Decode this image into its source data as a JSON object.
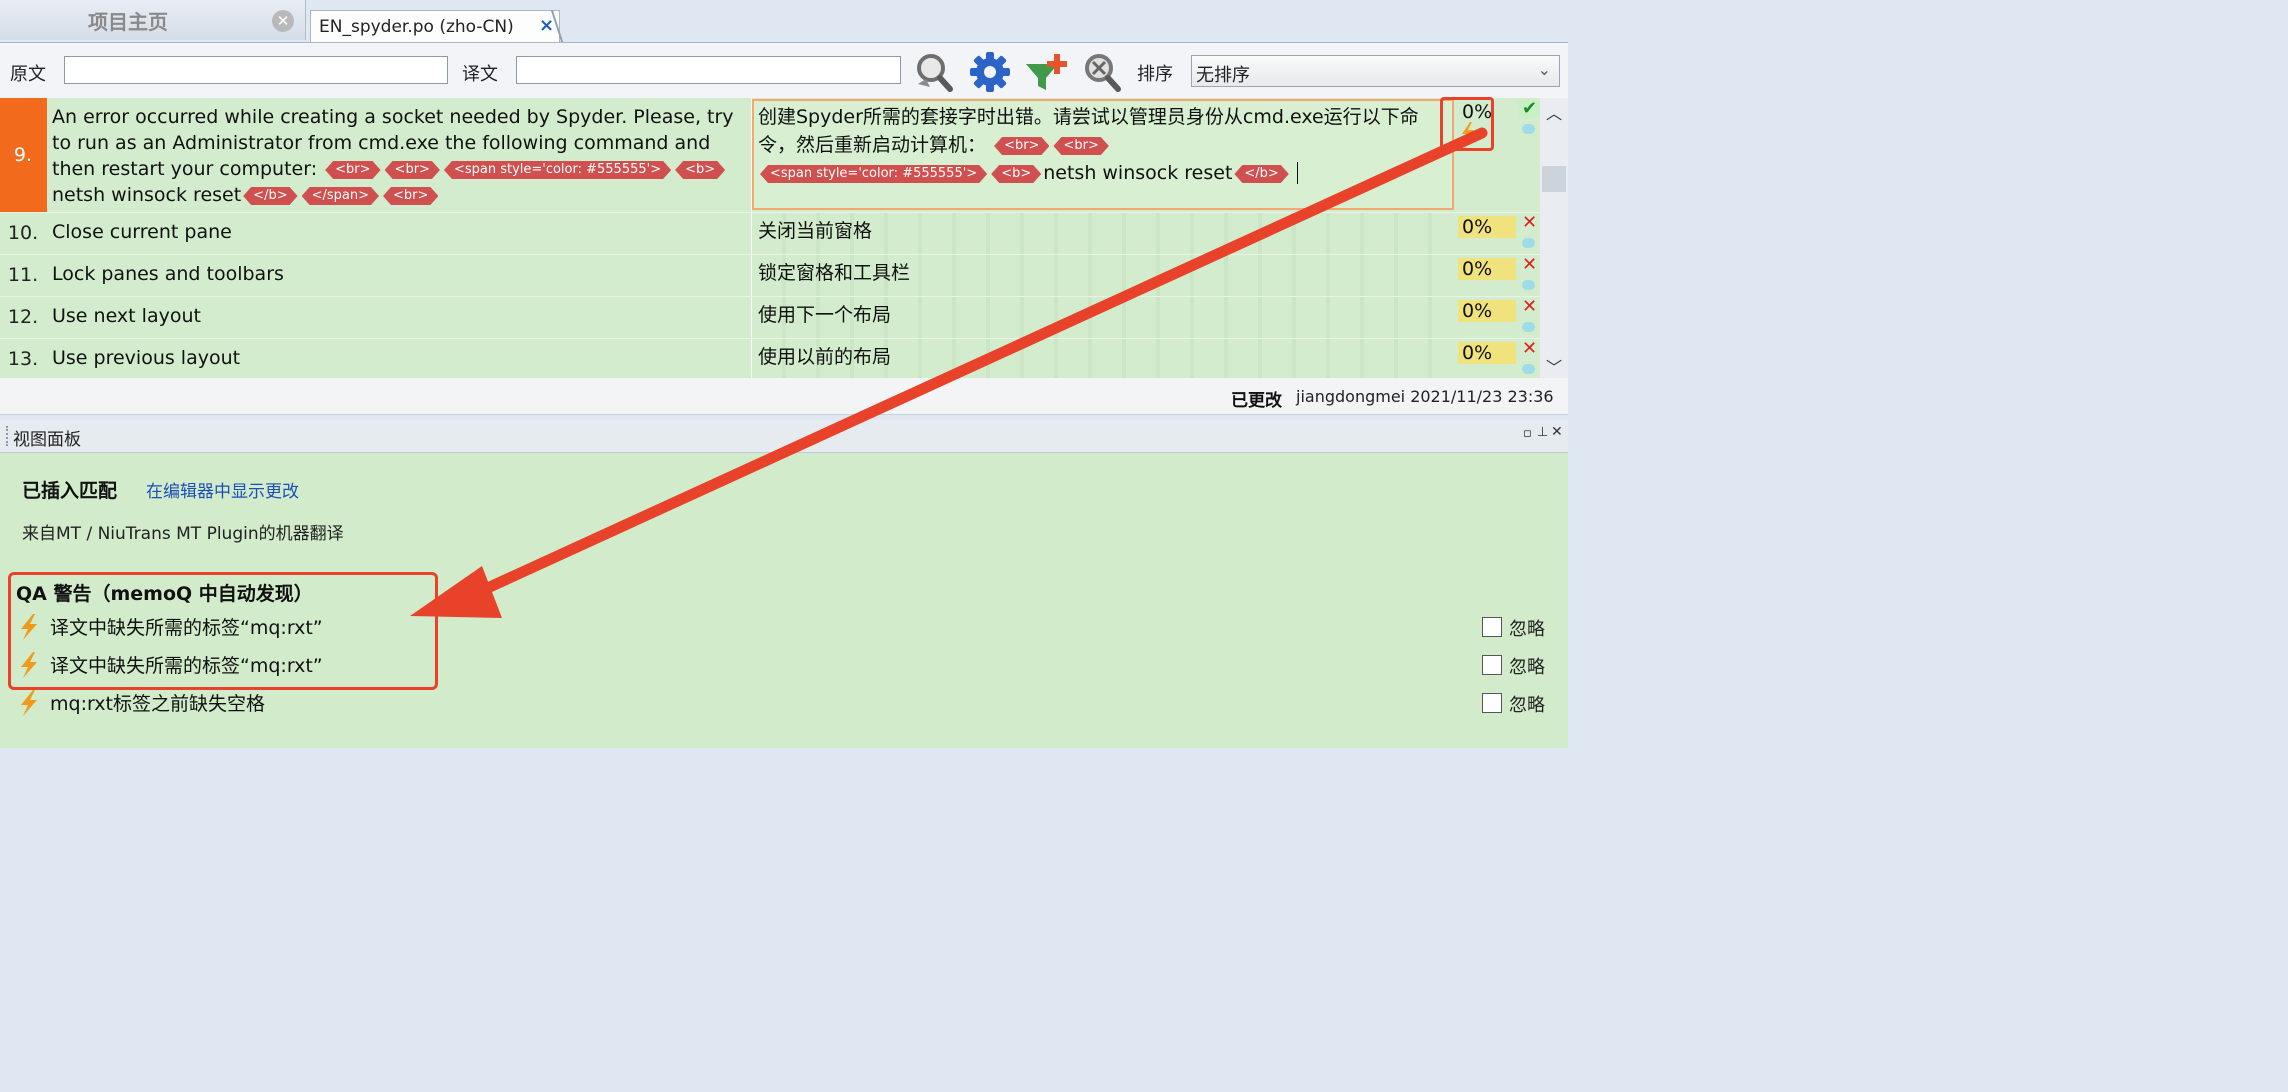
{
  "tabs": {
    "home_label": "项目主页",
    "doc_label": "EN_spyder.po (zho-CN)"
  },
  "filter": {
    "source_label": "原文",
    "target_label": "译文",
    "sort_label": "排序",
    "sort_value": "无排序"
  },
  "grid": {
    "active_row": {
      "num": "9.",
      "source_text_1": "An error occurred while creating a socket needed by Spyder. Please, try to run as an Administrator from cmd.exe the following command and then restart your computer:",
      "source_text_2": "netsh",
      "source_text_3": "winsock reset",
      "target_text_1": "创建Spyder所需的套接字时出错。请尝试以管理员身份从cmd.exe运行以下命令，然后重新启动计算机：",
      "target_text_2": "netsh winsock reset",
      "tag_br": "<br>",
      "tag_span": "<span style='color: #555555'>",
      "tag_b": "<b>",
      "tag_b_close": "</b>",
      "tag_span_close": "</span>",
      "match": "0%"
    },
    "rows": [
      {
        "num": "10.",
        "source": "Close current pane",
        "target": "关闭当前窗格",
        "match": "0%"
      },
      {
        "num": "11.",
        "source": "Lock panes and toolbars",
        "target": "锁定窗格和工具栏",
        "match": "0%"
      },
      {
        "num": "12.",
        "source": "Use next layout",
        "target": "使用下一个布局",
        "match": "0%"
      },
      {
        "num": "13.",
        "source": "Use previous layout",
        "target": "使用以前的布局",
        "match": "0%"
      }
    ]
  },
  "status": {
    "changed_label": "已更改",
    "user_date": "jiangdongmei 2021/11/23 23:36"
  },
  "view_panel": {
    "title": "视图面板",
    "inserted_match": "已插入匹配",
    "show_changes_link": "在编辑器中显示更改",
    "mt_source": "来自MT / NiuTrans MT Plugin的机器翻译",
    "qa_heading": "QA 警告（memoQ 中自动发现）",
    "warnings": [
      {
        "text": "译文中缺失所需的标签“mq:rxt”",
        "ignore": "忽略"
      },
      {
        "text": "译文中缺失所需的标签“mq:rxt”",
        "ignore": "忽略"
      },
      {
        "text": "mq:rxt标签之前缺失空格",
        "ignore": "忽略"
      }
    ]
  },
  "colors": {
    "row_green": "#d3eccd",
    "active_number": "#f26b1d",
    "tag_red": "#d05050",
    "annotation_red": "#e8432a",
    "match_yellow": "#f0e27c"
  }
}
